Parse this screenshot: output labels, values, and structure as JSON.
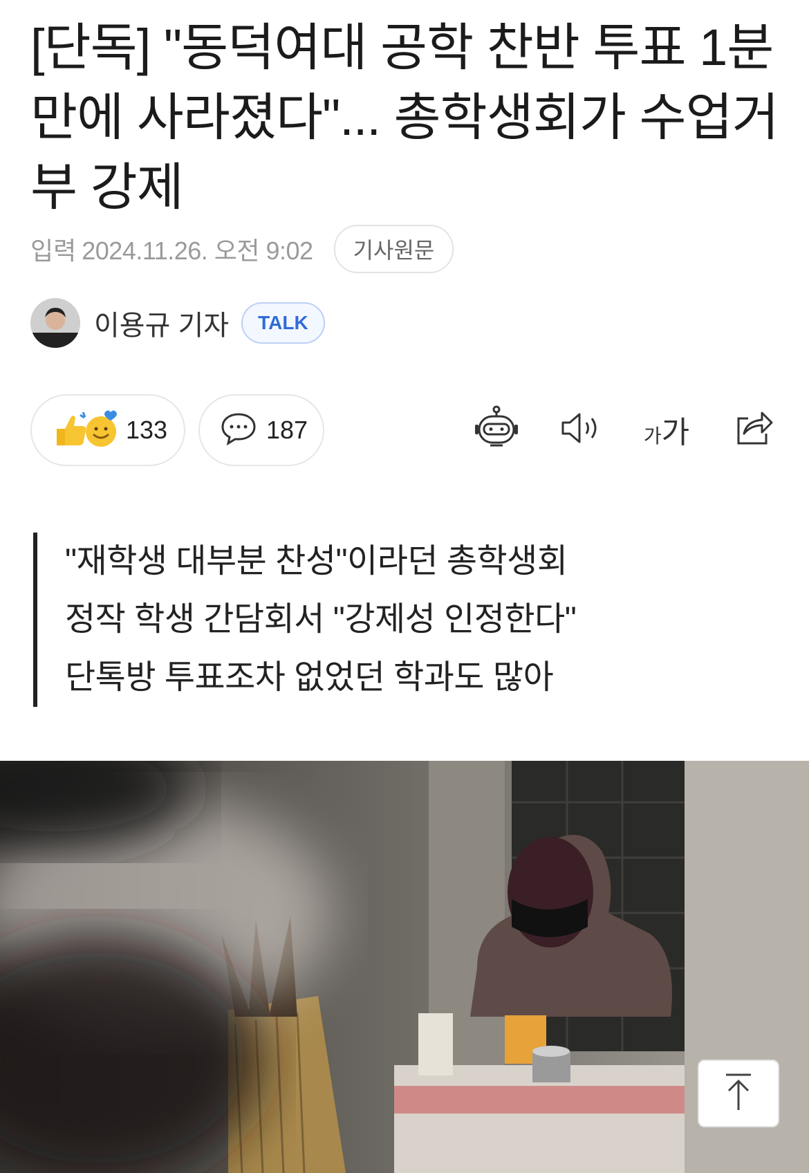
{
  "article": {
    "title": "[단독] \"동덕여대 공학 찬반 투표 1분 만에 사라졌다\"... 총학생회가 수업거부 강제",
    "date_label": "입력",
    "date": "2024.11.26. 오전 9:02",
    "original_button": "기사원문"
  },
  "author": {
    "name": "이용규 기자",
    "talk_label": "TALK"
  },
  "actions": {
    "reaction_count": "133",
    "comment_count": "187",
    "font_size_small": "가",
    "font_size_large": "가"
  },
  "summary": {
    "lines": [
      "\"재학생 대부분 찬성\"이라던 총학생회",
      "정작 학생 간담회서 \"강제성 인정한다\"",
      "단톡방 투표조차 없었던 학과도 많아"
    ]
  },
  "icons": {
    "reaction": "thumbs-up-emoji-icon",
    "comment": "speech-bubble-icon",
    "summary_bot": "robot-icon",
    "tts": "speaker-icon",
    "font_size": "font-size-icon",
    "share": "share-icon",
    "scroll_top": "arrow-up-icon"
  },
  "colors": {
    "talk_accent": "#2f6bd8",
    "summary_bar": "#222222",
    "meta_text": "#9a9a9a"
  }
}
